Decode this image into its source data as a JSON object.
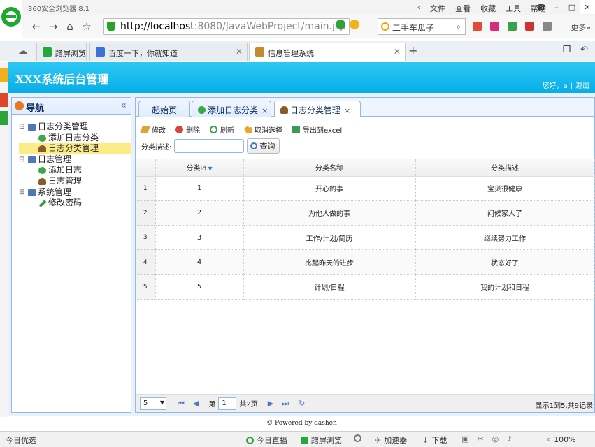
{
  "browser": {
    "title": "360安全浏览器 8.1",
    "menu": [
      "文件",
      "查看",
      "收藏",
      "工具",
      "帮助"
    ],
    "url_host": "http://localhost",
    "url_rest": ":8080/JavaWebProject/main.jsp",
    "search_text": "二手车瓜子",
    "more_label": "更多»",
    "tabs": [
      {
        "label": "蹭屏浏览"
      },
      {
        "label": "百度一下，你就知道"
      },
      {
        "label": "信息管理系统"
      }
    ]
  },
  "app": {
    "title": "XXX系统后台管理",
    "greeting": "您好，a",
    "logout_label": "退出",
    "nav_title": "导航",
    "tree": [
      {
        "label": "日志分类管理",
        "toggle": "⊟"
      },
      {
        "label": "添加日志分类"
      },
      {
        "label": "日志分类管理"
      },
      {
        "label": "日志管理",
        "toggle": "⊟"
      },
      {
        "label": "添加日志"
      },
      {
        "label": "日志管理"
      },
      {
        "label": "系统管理",
        "toggle": "⊟"
      },
      {
        "label": "修改密码"
      }
    ],
    "content_tabs": [
      {
        "label": "起始页"
      },
      {
        "label": "添加日志分类",
        "close": "×"
      },
      {
        "label": "日志分类管理",
        "close": "×"
      }
    ],
    "toolbar": {
      "edit": "修改",
      "delete": "删除",
      "refresh": "刷新",
      "cancel_select": "取消选择",
      "export": "导出到excel"
    },
    "filter": {
      "label": "分类描述:",
      "query_label": "查询"
    },
    "grid": {
      "columns": [
        "分类id",
        "分类名称",
        "分类描述"
      ],
      "rows": [
        {
          "rn": "1",
          "id": "1",
          "name": "开心的事",
          "desc": "宝贝很健康"
        },
        {
          "rn": "2",
          "id": "2",
          "name": "为他人做的事",
          "desc": "问候家人了"
        },
        {
          "rn": "3",
          "id": "3",
          "name": "工作/计划/简历",
          "desc": "继续努力工作"
        },
        {
          "rn": "4",
          "id": "4",
          "name": "比起昨天的进步",
          "desc": "状态好了"
        },
        {
          "rn": "5",
          "id": "5",
          "name": "计划/日程",
          "desc": "我的计划和日程"
        }
      ]
    },
    "pager": {
      "page_size": "5",
      "page_label": "第",
      "page_value": "1",
      "page_total": "共2页",
      "info": "显示1到5,共9记录"
    },
    "footer": "© Powered by dashen"
  },
  "status": {
    "left": "今日优选",
    "live": "今日直播",
    "screen": "蹭屏浏览",
    "accel": "加速器",
    "download": "下载",
    "zoom": "100%"
  }
}
